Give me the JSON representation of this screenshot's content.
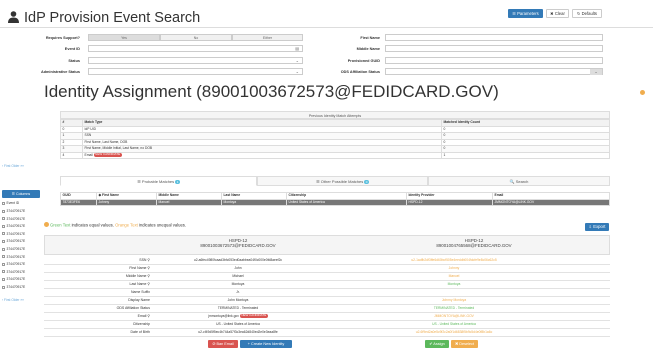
{
  "page": {
    "title": "IdP Provision Event Search"
  },
  "header": {
    "parameters": "☰ Parameters",
    "clear": "✖ Clear",
    "defaults": "↻ Defaults"
  },
  "form": {
    "requires_support": "Requires Support?",
    "seg_yes": "Yes",
    "seg_no": "No",
    "seg_either": "Either",
    "event_id": "Event ID",
    "status": "Status",
    "admin_status": "Administrative Status",
    "first_name": "First Name",
    "middle_name": "Middle Name",
    "provisioned_guid": "Provisioned GUID",
    "ods_status": "ODS Affiliation Status"
  },
  "identity": {
    "title": "Identity Assignment (89001003672573@FEDIDCARD.GOV)"
  },
  "attempts": {
    "caption": "Previous Identity Match Attempts",
    "headers": [
      "#",
      "Match Type",
      "Matched Identity Count"
    ],
    "rows": [
      [
        "0",
        "IdP UID",
        "0"
      ],
      [
        "1",
        "SSN",
        "0"
      ],
      [
        "2",
        "First Name, Last Name, DOB",
        "0"
      ],
      [
        "3",
        "First Name, Middle Initial, Last Name, no DOB",
        "0"
      ],
      [
        "4",
        "Email",
        "1"
      ]
    ],
    "new_candidate": "NEW CANDIDATE"
  },
  "sidebar": {
    "link_top": "‹ First Older »»",
    "columns_btn": "☰ Columns",
    "event_id": "Event ID",
    "items": [
      "374470917E",
      "374470917E",
      "374470917E",
      "374470917E",
      "374470917E",
      "374470917E",
      "374470917E",
      "374470917E",
      "374470917E",
      "374470917E",
      "374470917E"
    ],
    "link_bottom": "‹ First Older »»"
  },
  "tabs": {
    "probable": "☰ Probable Matches",
    "probable_count": "1",
    "other": "☰ Other Possible Matches",
    "other_count": "0",
    "search": "🔍 Search"
  },
  "matches": {
    "headers": [
      "GUID",
      "◆ First Name",
      "Middle Name",
      "Last Name",
      "Citizenship",
      "Identity Provider",
      "Email"
    ],
    "row": [
      "7873E3FE6",
      "Johnny",
      "Manuel",
      "Montoya",
      "United States of America",
      "HSPD-12",
      "JMMONTOYA@LINK.GOV"
    ]
  },
  "legend": {
    "green": "Green Text",
    "mid": " indicates equal values. ",
    "orange": "Orange Text",
    "end": " indicates unequal values."
  },
  "export_btn": "⇩ Export",
  "compare": {
    "left_head": "HSPD-12",
    "left_sub": "89001003672573@FEDIDCARD.GOV",
    "right_head": "HSPD-12",
    "right_sub": "89001004765568@FEDIDCARD.GOV",
    "rows": [
      {
        "label": "SSN",
        "left": "u2-a6fec4980fcaad3bfc053ed0aabbea04f0c000e0fd8aeef2c",
        "right": "u2-1adfb2df3ffe6d60bcf505e4eeddb004fdcfe9e8c06c62c5"
      },
      {
        "label": "First Name",
        "left": "John",
        "right": "Johnny"
      },
      {
        "label": "Middle Name",
        "left": "Michael",
        "right": "Manuel"
      },
      {
        "label": "Last Name",
        "left": "Montoya",
        "right": "Montoya"
      },
      {
        "label": "Name Suffix",
        "left": "Jr.",
        "right": ""
      },
      {
        "label": "Display Name",
        "left": "John Montoya",
        "right": "Johnny Montoya"
      },
      {
        "label": "ODS Affiliation Status",
        "left": "TERMINATED - Terminated",
        "right": "TERMINATED - Terminated"
      },
      {
        "label": "Email",
        "left": "jmmontoya@link.gov",
        "right": "JMMONTOYA@LINK.GOV"
      },
      {
        "label": "Citizenship",
        "left": "US - United States of America",
        "right": "US - United States of America"
      },
      {
        "label": "Date of Birth",
        "left": "u2-cf49d5f5ec4b744a57f3c3ea62d840ed2e0e3eaa8fe",
        "right": "u2-6f9ed2a0e5c9f2c2a0f1d6838f5b9c5d4e0f8b1a6c"
      }
    ]
  },
  "footer": {
    "ban": "⊘ Ban Email",
    "create": "+ Create New Identity",
    "assign": "✔ Assign",
    "deselect": "✖ Deselect"
  },
  "colors": {
    "green": "#5cb85c",
    "orange": "#f0ad4e",
    "blue": "#337ab7",
    "red": "#d9534f"
  }
}
